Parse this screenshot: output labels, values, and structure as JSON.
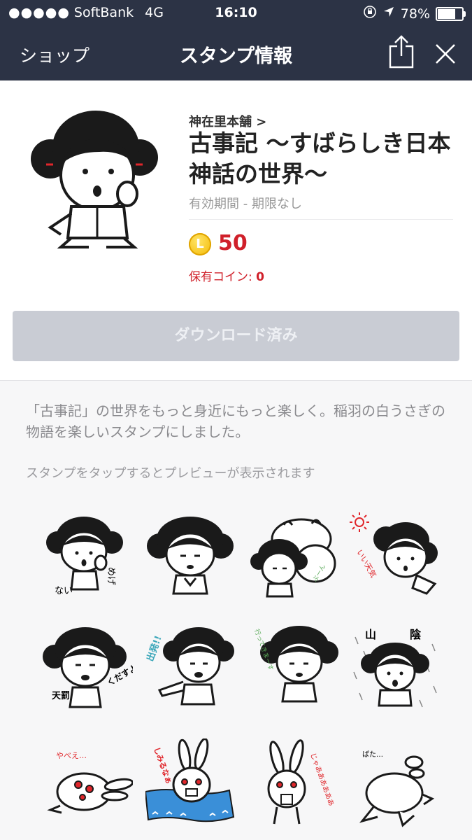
{
  "status_bar": {
    "carrier": "SoftBank",
    "network": "4G",
    "time": "16:10",
    "battery": "78%",
    "battery_level": 0.78
  },
  "nav": {
    "back_label": "ショップ",
    "title": "スタンプ情報"
  },
  "sticker_pack": {
    "creator": "神在里本舗",
    "name": "古事記 〜すばらしき日本神話の世界〜",
    "validity": "有効期間 - 期限なし",
    "coin_symbol": "L",
    "price": "50",
    "owned_label": "保有コイン: ",
    "owned_value": "0",
    "download_label": "ダウンロード済み"
  },
  "description": "「古事記」の世界をもっと身近にもっと楽しく。稲羽の白うさぎの物語を楽しいスタンプにしました。",
  "preview_hint": "スタンプをタップするとプレビューが表示されます",
  "sticker_texts": {
    "s1_a": "めげ",
    "s1_b": "ない",
    "s4": "いい天気",
    "s5_a": "天罰",
    "s5_b": "くだすよ",
    "s6": "出発!!",
    "s7": "行ってきまーす",
    "s8_a": "山",
    "s8_b": "陰",
    "s9": "やべえ…",
    "s10": "しみるなぁ",
    "s11": "じゃああああああ",
    "s12": "ぱた…"
  }
}
